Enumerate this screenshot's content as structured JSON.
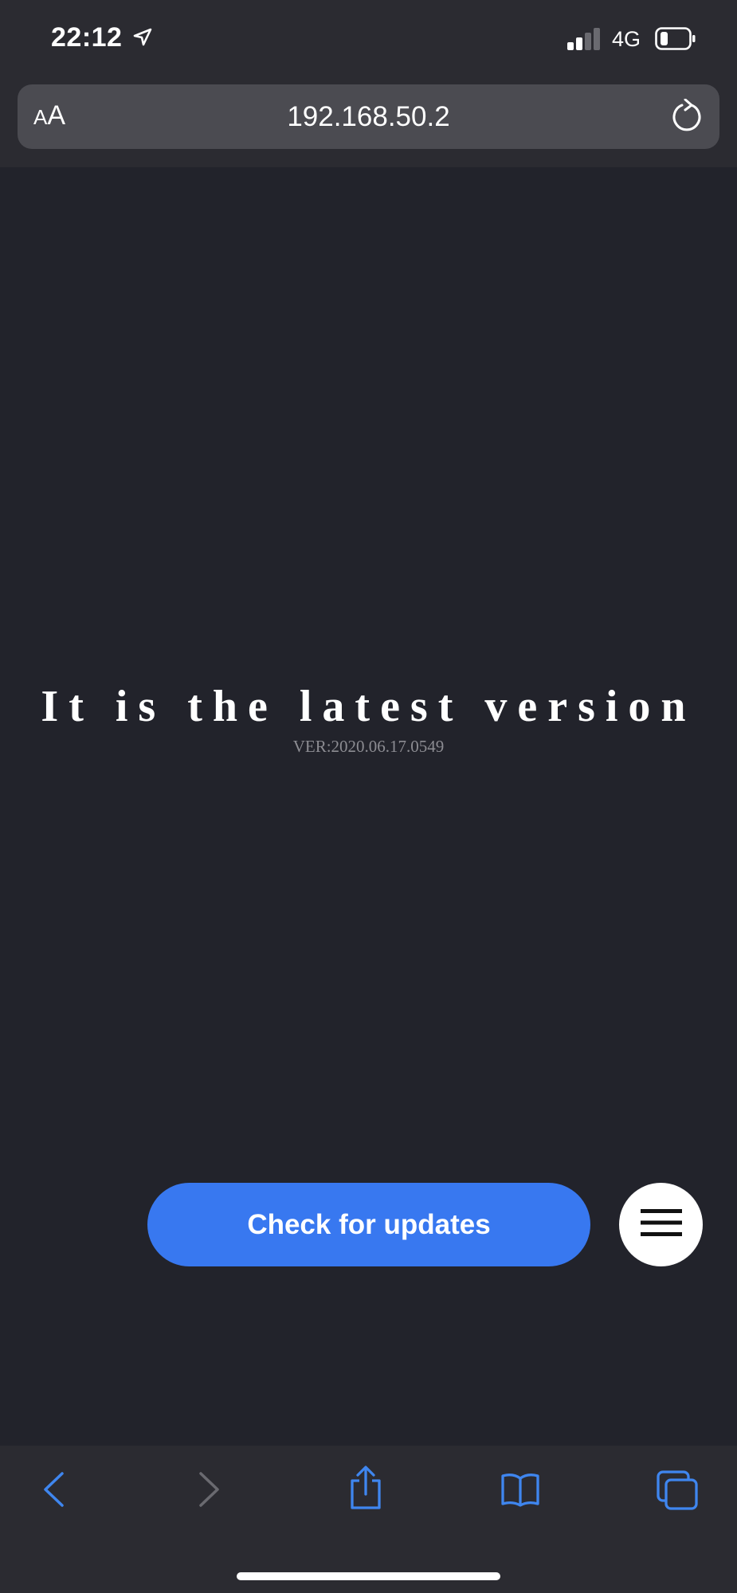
{
  "status": {
    "time": "22:12",
    "network": "4G"
  },
  "browser": {
    "text_size_label_small": "A",
    "text_size_label_large": "A",
    "url": "192.168.50.2"
  },
  "main": {
    "headline": "It is the latest version",
    "version": "VER:2020.06.17.0549",
    "check_button_label": "Check for updates"
  },
  "colors": {
    "accent": "#3878f0",
    "ios_blue": "#3f86ef",
    "background": "#22232b"
  },
  "icons": {
    "location": "location-arrow-icon",
    "signal": "cellular-signal-icon",
    "battery": "battery-icon",
    "reload": "reload-icon",
    "menu": "hamburger-menu-icon",
    "back": "chevron-left-icon",
    "forward": "chevron-right-icon",
    "share": "share-icon",
    "bookmarks": "book-icon",
    "tabs": "tabs-icon"
  }
}
